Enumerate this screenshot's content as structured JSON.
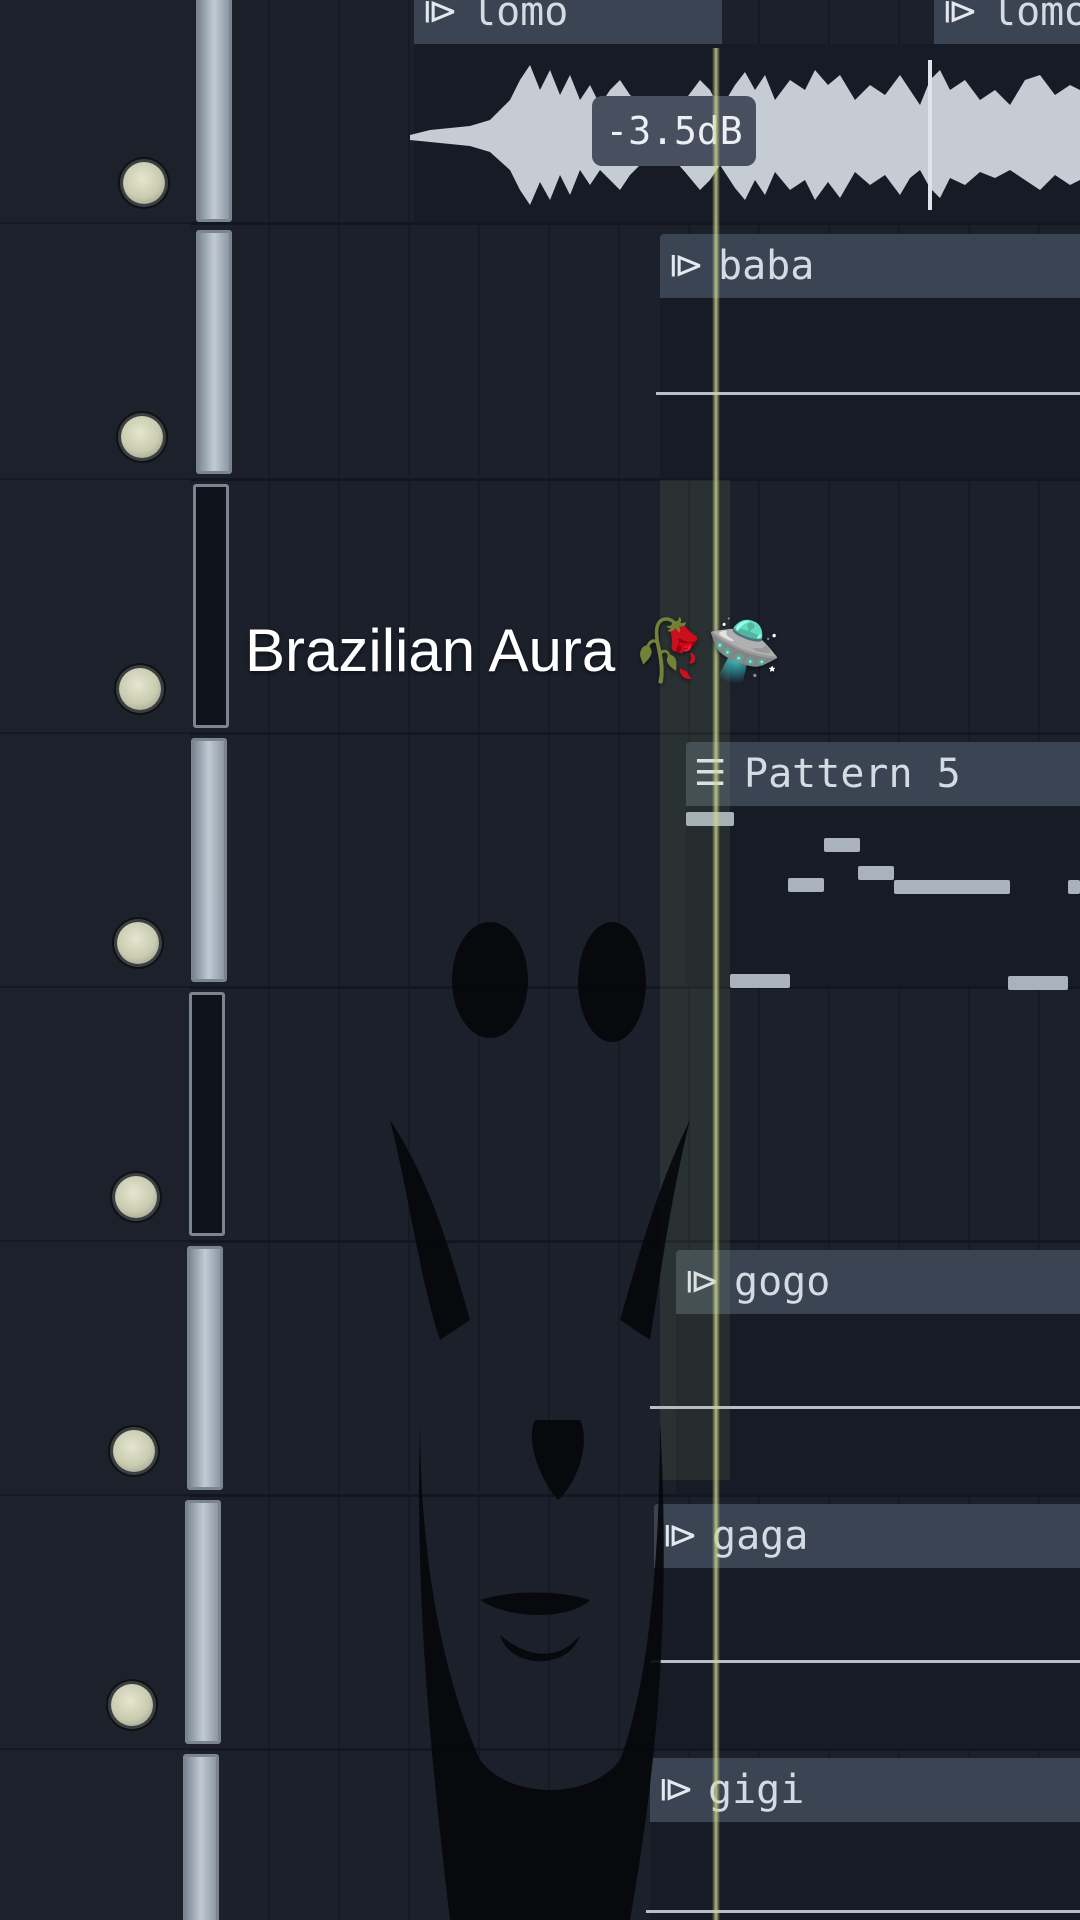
{
  "gain_label": "-3.5dB",
  "overlay_caption": "Brazilian Aura 🥀🛸",
  "tracks": [
    {
      "clip": "lomo",
      "clip2": "lomo"
    },
    {
      "clip": "baba"
    },
    {
      "clip": ""
    },
    {
      "clip": "Pattern 5"
    },
    {
      "clip": ""
    },
    {
      "clip": "gogo"
    },
    {
      "clip": "gaga"
    },
    {
      "clip": "gigi"
    }
  ],
  "icons": {
    "audio_clip": "audio-clip-icon",
    "pattern_clip": "pattern-clip-icon",
    "mute": "track-mute-icon"
  },
  "colors": {
    "background": "#1b202b",
    "clip_header": "#3a4452",
    "playhead": "#cdd58a",
    "waveform": "#c5ccd3"
  }
}
